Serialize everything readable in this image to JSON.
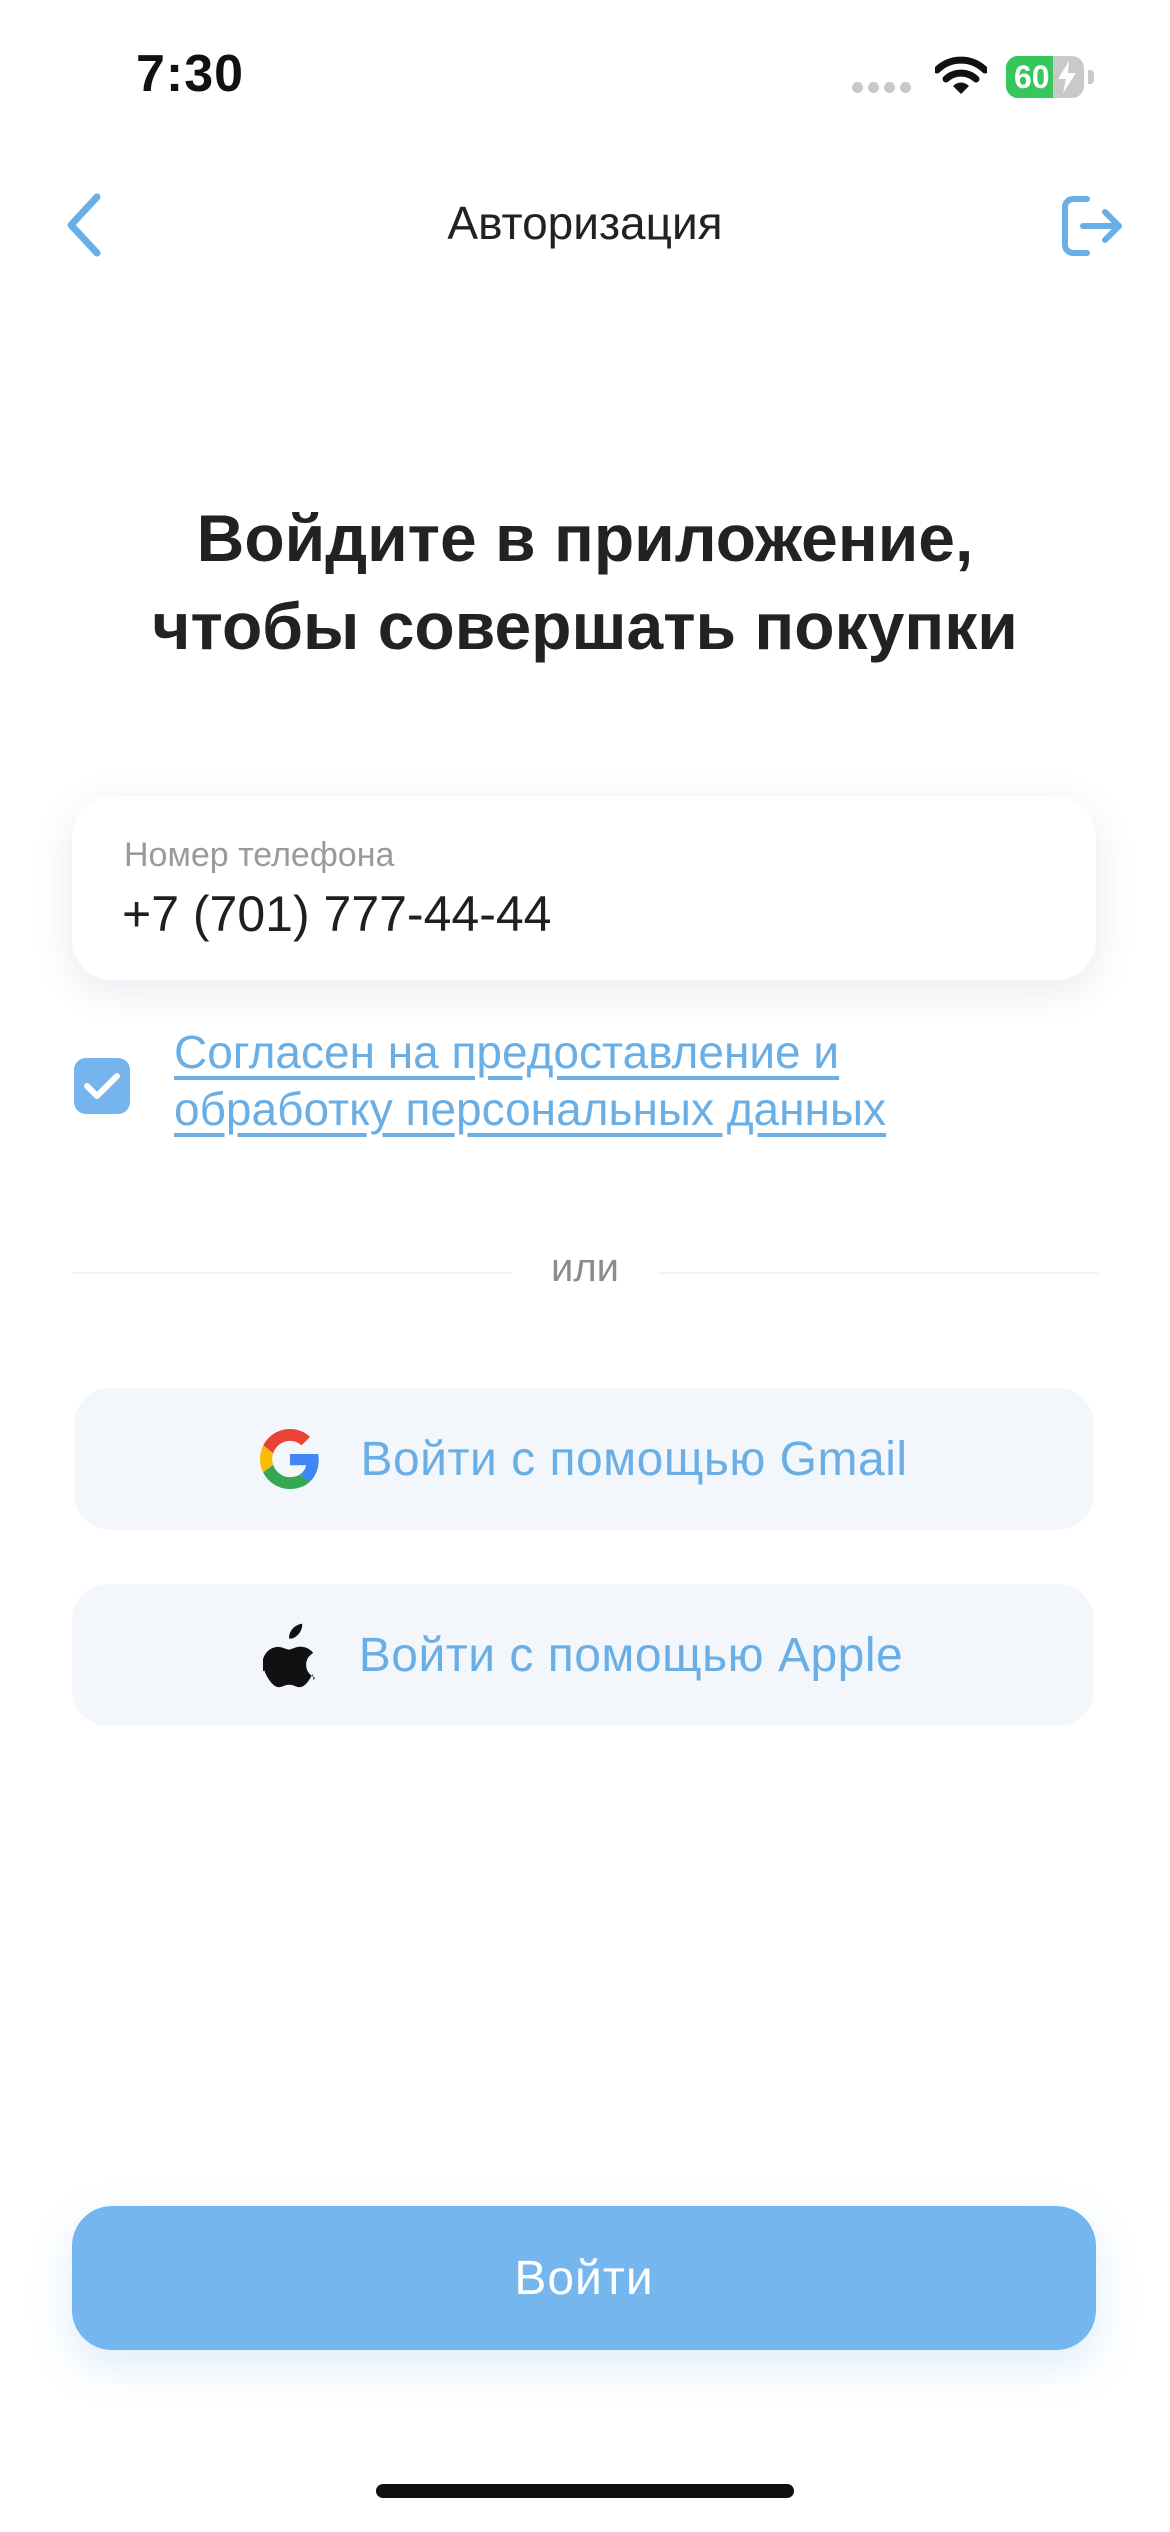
{
  "status_bar": {
    "time": "7:30",
    "battery_percent": "60",
    "battery_level": 0.6,
    "battery_color": "#35c759"
  },
  "nav": {
    "title": "Авторизация",
    "back_icon": "chevron-left-icon",
    "exit_icon": "sign-out-icon"
  },
  "heading": {
    "line1": "Войдите в приложение,",
    "line2": "чтобы совершать покупки"
  },
  "phone": {
    "label": "Номер телефона",
    "value": "+7 (701) 777-44-44"
  },
  "consent": {
    "checked": true,
    "line1": "Согласен на предоставление и",
    "line2": "обработку персональных данных"
  },
  "divider": {
    "text": "или"
  },
  "social": {
    "gmail_label": "Войти с помощью Gmail",
    "gmail_icon": "google-icon",
    "apple_label": "Войти с помощью Apple",
    "apple_icon": "apple-icon"
  },
  "login": {
    "label": "Войти"
  },
  "colors": {
    "accent": "#6aaee6",
    "primary_button": "#76b6ef",
    "social_bg": "#f3f7fc"
  }
}
